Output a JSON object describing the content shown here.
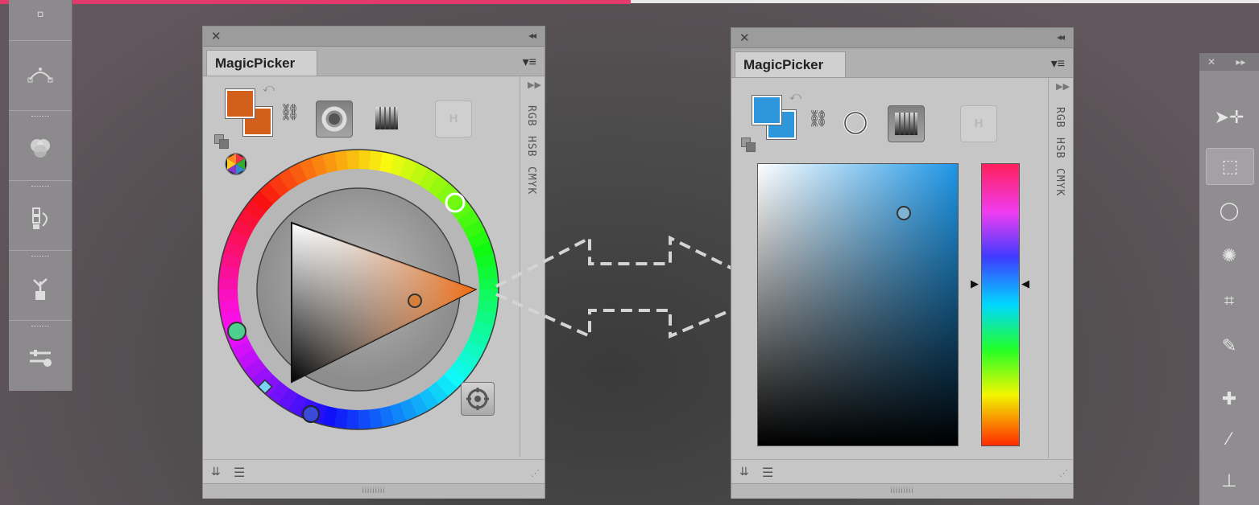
{
  "accent_color": "#e13a6b",
  "left_strip": {
    "icons": [
      "bezier-path-icon",
      "color-circles-icon",
      "swap-layers-icon",
      "plant-pot-icon",
      "sliders-brush-icon"
    ]
  },
  "panel_left": {
    "close_glyph": "✕",
    "collapse_glyph": "◂◂",
    "tab_label": "MagicPicker",
    "menu_glyph": "▾≡",
    "mode_labels": [
      "RGB",
      "HSB",
      "CMYK"
    ],
    "foreground_color": "#d2601c",
    "background_color": "#d2601c",
    "selected_color": "#f27b22",
    "mode_button_label": "H",
    "picker": "color-wheel"
  },
  "panel_right": {
    "close_glyph": "✕",
    "collapse_glyph": "◂◂",
    "tab_label": "MagicPicker",
    "menu_glyph": "▾≡",
    "mode_labels": [
      "RGB",
      "HSB",
      "CMYK"
    ],
    "foreground_color": "#2e97dc",
    "background_color": "#2e97dc",
    "mode_button_label": "H",
    "picker": "color-field-with-hue-slider"
  },
  "footer": {
    "grip_text": "iiiiiiiii"
  },
  "right_strip": {
    "close_glyph": "✕",
    "expand_glyph": "▸▸",
    "tools": [
      "move-tool-icon",
      "marquee-tool-icon",
      "lasso-tool-icon",
      "magic-wand-icon",
      "crop-tool-icon",
      "eyedropper-icon",
      "healing-brush-icon",
      "brush-tool-icon",
      "stamp-tool-icon"
    ]
  }
}
